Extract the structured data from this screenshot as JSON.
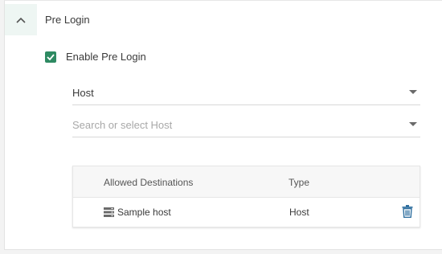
{
  "section": {
    "title": "Pre Login"
  },
  "enable_pre_login": {
    "label": "Enable Pre Login",
    "checked": true
  },
  "type_select": {
    "value": "Host"
  },
  "host_select": {
    "placeholder": "Search or select Host"
  },
  "destinations_table": {
    "columns": [
      "Allowed Destinations",
      "Type"
    ],
    "rows": [
      {
        "name": "Sample host",
        "type": "Host",
        "icon": "server-icon"
      }
    ]
  },
  "colors": {
    "accent": "#2e8a62",
    "toggle_bg": "#eef6f3",
    "trash_icon": "#2f6f9f"
  },
  "icons": {
    "collapse": "chevron-up-icon",
    "checkbox": "checkmark-icon",
    "row_type": "server-icon",
    "row_delete": "trash-icon"
  }
}
